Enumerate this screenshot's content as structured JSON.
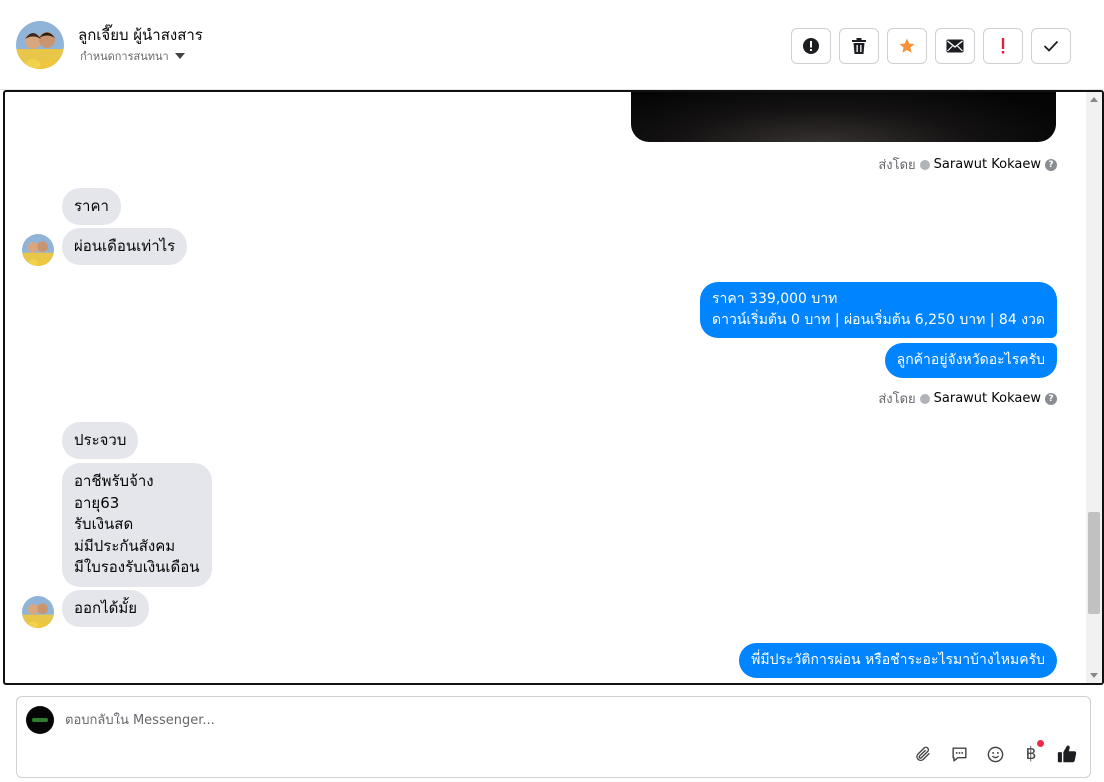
{
  "header": {
    "contact_name": "ลูกเจี๊ยบ ผู้นำสงสาร",
    "assign_label": "กำหนดการสนทนา",
    "actions": [
      {
        "name": "alert-circle-button",
        "icon": "alert-circle-icon"
      },
      {
        "name": "delete-button",
        "icon": "trash-icon"
      },
      {
        "name": "star-button",
        "icon": "star-icon"
      },
      {
        "name": "mark-unread-button",
        "icon": "envelope-icon"
      },
      {
        "name": "mark-important-button",
        "icon": "exclamation-icon"
      },
      {
        "name": "mark-done-button",
        "icon": "check-icon"
      }
    ],
    "star_color": "#f7923a",
    "important_color": "#e41e3f"
  },
  "chat": {
    "sent_by_label": "ส่งโดย",
    "agent_name": "Sarawut Kokaew",
    "messages": {
      "in_1": "ราคา",
      "in_2": "ผ่อนเดือนเท่าไร",
      "out_1_line1": "ราคา 339,000 บาท",
      "out_1_line2": "ดาวน์เริ่มต้น 0 บาท | ผ่อนเริ่มต้น 6,250 บาท | 84 งวด",
      "out_2": "ลูกค้าอยู่จังหวัดอะไรครับ",
      "in_3": "ประจวบ",
      "in_4_lines": [
        "อาชีพรับจ้าง",
        "อายุ63",
        "รับเงินสด",
        "ม่มีประกันสังคม",
        "มีใบรองรับเงินเดือน"
      ],
      "in_5": "ออกได้มั้ย",
      "out_3": "พี่มีประวัติการผ่อน หรือชำระอะไรมาบ้างไหมครับ"
    },
    "outgoing_color": "#0084ff",
    "incoming_color": "#e4e6eb"
  },
  "composer": {
    "placeholder": "ตอบกลับใน Messenger...",
    "tools": [
      "attachment-icon",
      "saved-replies-icon",
      "emoji-icon",
      "baht-payment-icon",
      "thumbs-up-icon"
    ]
  }
}
